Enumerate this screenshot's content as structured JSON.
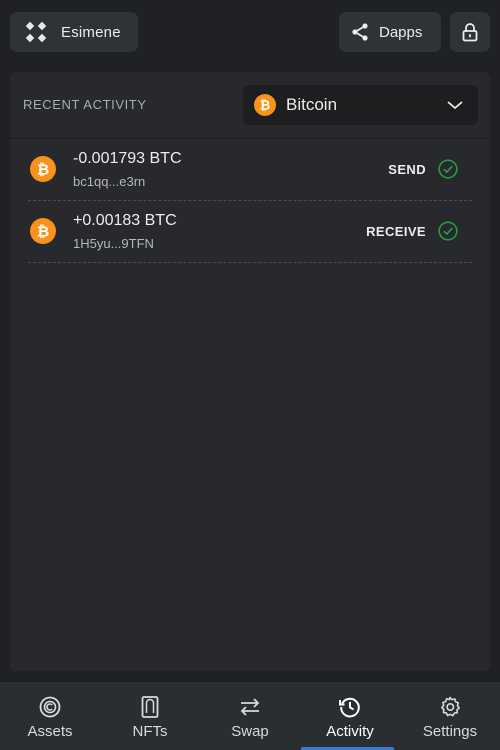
{
  "header": {
    "account_name": "Esimene",
    "dapps_label": "Dapps",
    "icons": {
      "account": "wallet-logo-icon",
      "dapps": "share-icon",
      "lock": "lock-icon"
    }
  },
  "activity": {
    "title": "RECENT ACTIVITY",
    "selected_coin": "Bitcoin",
    "transactions": [
      {
        "amount": "-0.001793 BTC",
        "address": "bc1qq...e3rn",
        "type": "SEND",
        "status": "confirmed"
      },
      {
        "amount": "+0.00183 BTC",
        "address": "1H5yu...9TFN",
        "type": "RECEIVE",
        "status": "confirmed"
      }
    ]
  },
  "nav": {
    "items": [
      {
        "label": "Assets",
        "icon": "assets-icon"
      },
      {
        "label": "NFTs",
        "icon": "nft-icon"
      },
      {
        "label": "Swap",
        "icon": "swap-icon"
      },
      {
        "label": "Activity",
        "icon": "activity-icon"
      },
      {
        "label": "Settings",
        "icon": "settings-icon"
      }
    ],
    "active": "Activity"
  },
  "colors": {
    "background": "#1f2124",
    "panel": "#27292c",
    "bitcoin": "#f7931a",
    "success": "#27a243",
    "active_tab": "#3a7bd5"
  }
}
